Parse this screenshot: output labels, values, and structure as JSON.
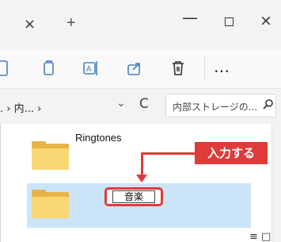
{
  "titlebar": {
    "tab_close": "×",
    "new_tab": "+",
    "minimize": "—",
    "close": "×"
  },
  "toolbar": {
    "icons": [
      "cut-icon",
      "copy-icon",
      "rename-icon",
      "share-icon",
      "delete-icon"
    ],
    "more": "…"
  },
  "address": {
    "breadcrumb": ". › 内... ›",
    "chevron": "⌄",
    "refresh": "C",
    "search_placeholder": "内部ストレージの...",
    "search_icon": "⌕"
  },
  "content": {
    "items": [
      {
        "name": "Ringtones",
        "icon": "folder-icon"
      },
      {
        "name": "音楽",
        "icon": "folder-icon",
        "state": "renaming"
      }
    ],
    "annotation": "入力する",
    "view_icons": "≡ □"
  },
  "colors": {
    "accent_red": "#e03a3a",
    "selection": "#cce4f7",
    "folder": "#f8d775"
  }
}
